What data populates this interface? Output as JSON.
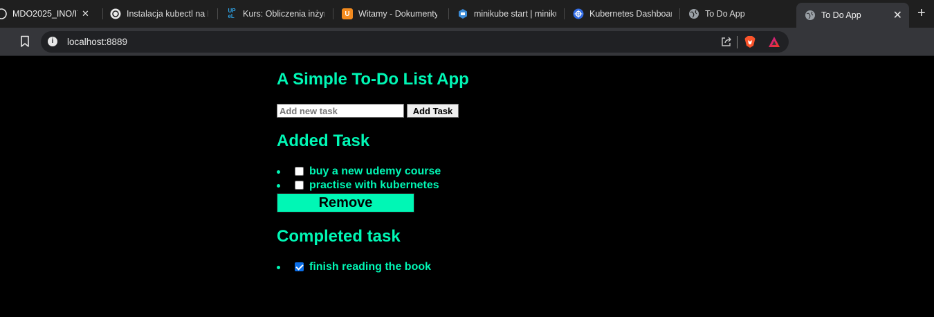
{
  "browser": {
    "tabs": [
      {
        "title": "MDO2025_INO/IT",
        "icon": "gitlab-icon"
      },
      {
        "title": "Instalacja kubectl na Fe",
        "icon": "chatgpt-icon"
      },
      {
        "title": "Kurs: Obliczenia inżyni",
        "icon": "upel-icon"
      },
      {
        "title": "Witamy - Dokumenty",
        "icon": "usos-icon"
      },
      {
        "title": "minikube start | miniku",
        "icon": "minikube-icon"
      },
      {
        "title": "Kubernetes Dashboard",
        "icon": "kubernetes-icon"
      },
      {
        "title": "To Do App",
        "icon": "globe-icon"
      },
      {
        "title": "To Do App",
        "icon": "globe-icon",
        "active": true
      }
    ],
    "close_glyph": "✕",
    "new_tab_glyph": "+",
    "url": "localhost:8889",
    "info_glyph": "i"
  },
  "app": {
    "title": "A Simple To-Do List App",
    "input_placeholder": "Add new task",
    "add_button": "Add Task",
    "added_heading": "Added Task",
    "added_tasks": [
      {
        "text": "buy a new udemy course",
        "checked": false
      },
      {
        "text": "practise with kubernetes",
        "checked": false
      }
    ],
    "remove_button": "Remove",
    "completed_heading": "Completed task",
    "completed_tasks": [
      {
        "text": "finish reading the book",
        "checked": true
      }
    ]
  },
  "colors": {
    "accent": "#00f7b5",
    "page_background": "#000000",
    "checkbox_checked": "#0b6ee8"
  }
}
